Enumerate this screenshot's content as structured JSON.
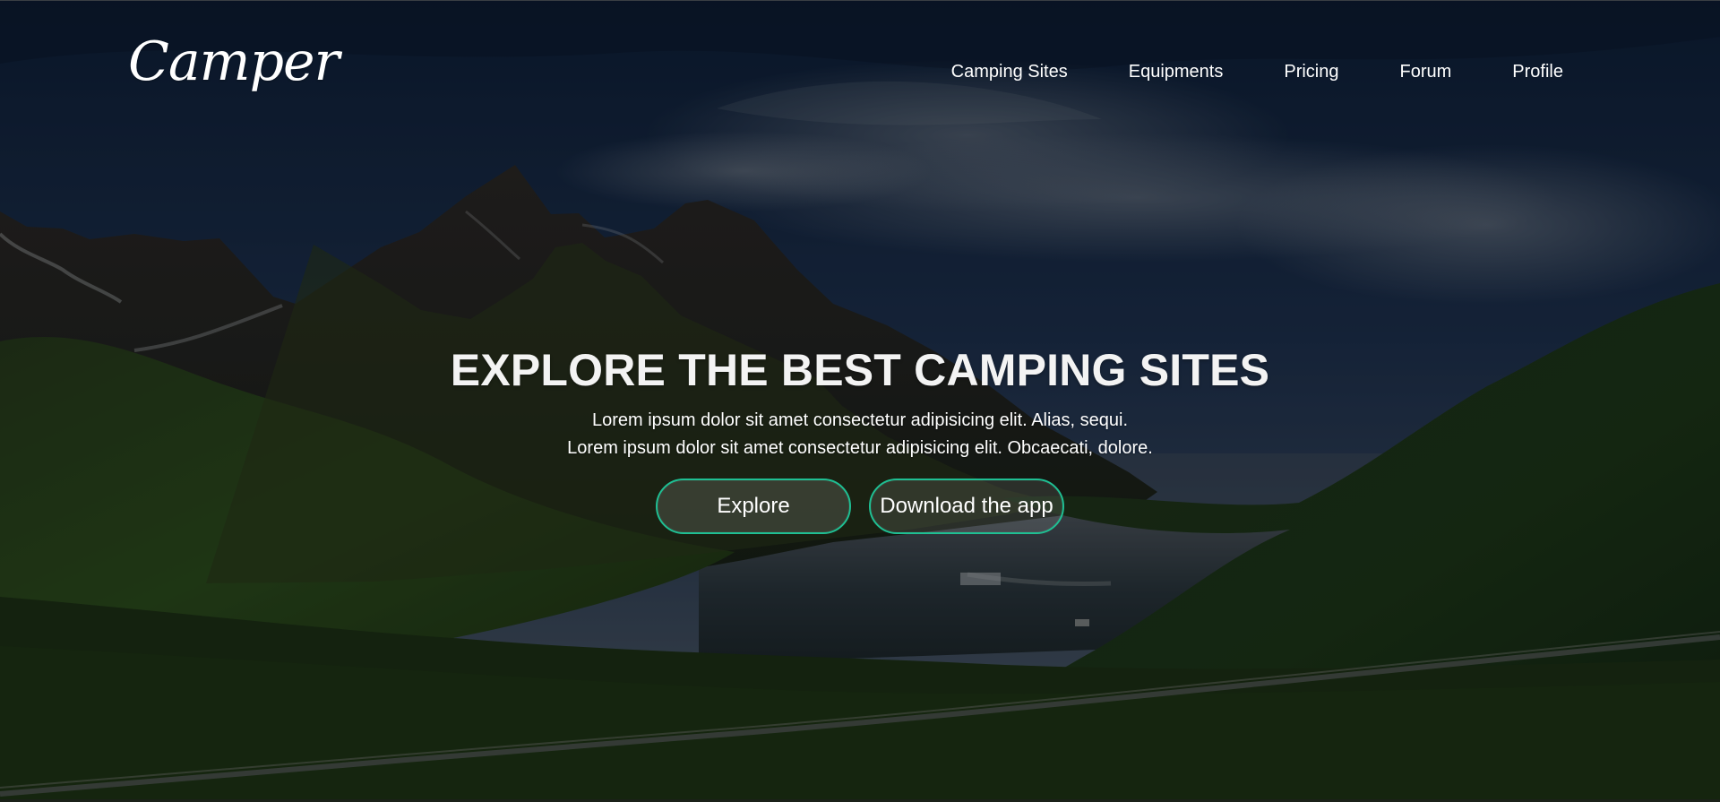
{
  "brand": {
    "logo_text": "Camper"
  },
  "navigation": {
    "items": [
      {
        "label": "Camping Sites"
      },
      {
        "label": "Equipments"
      },
      {
        "label": "Pricing"
      },
      {
        "label": "Forum"
      },
      {
        "label": "Profile"
      }
    ]
  },
  "hero": {
    "title": "EXPLORE THE BEST CAMPING SITES",
    "subtitle_lines": [
      "Lorem ipsum dolor sit amet consectetur adipisicing elit. Alias, sequi.",
      "Lorem ipsum dolor sit amet consectetur adipisicing elit. Obcaecati, dolore."
    ],
    "buttons": [
      {
        "label": "Explore"
      },
      {
        "label": "Download the app"
      }
    ]
  },
  "colors": {
    "accent": "#1fbf93",
    "text": "#ffffff"
  }
}
